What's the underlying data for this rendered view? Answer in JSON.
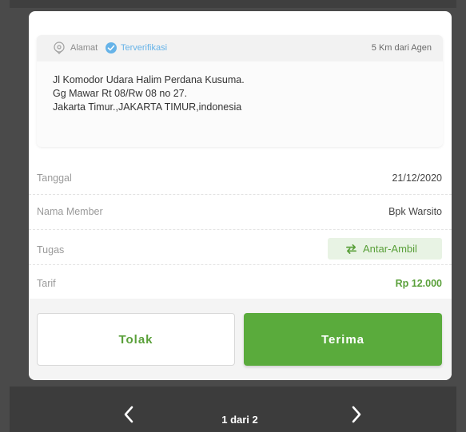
{
  "address": {
    "label": "Alamat",
    "verified_label": "Terverifikasi",
    "distance": "5 Km dari Agen",
    "lines": [
      "Jl Komodor Udara Halim Perdana Kusuma.",
      "Gg Mawar Rt 08/Rw 08 no 27.",
      "Jakarta Timur.,JAKARTA TIMUR,indonesia"
    ],
    "pin_icon": "location-pin-icon",
    "check_icon": "check-circle-icon"
  },
  "details": {
    "date_label": "Tanggal",
    "date_value": "21/12/2020",
    "member_label": "Nama Member",
    "member_value": "Bpk Warsito",
    "task_label": "Tugas",
    "task_value": "Antar-Ambil",
    "task_icon": "swap-arrows-icon",
    "tariff_label": "Tarif",
    "tariff_value": "Rp 12.000"
  },
  "actions": {
    "reject_label": "Tolak",
    "accept_label": "Terima"
  },
  "pagination": {
    "text": "1 dari 2"
  },
  "colors": {
    "accent_green": "#5aab3c",
    "verified_blue": "#66b3e8",
    "overlay": "#4a4a4a"
  }
}
